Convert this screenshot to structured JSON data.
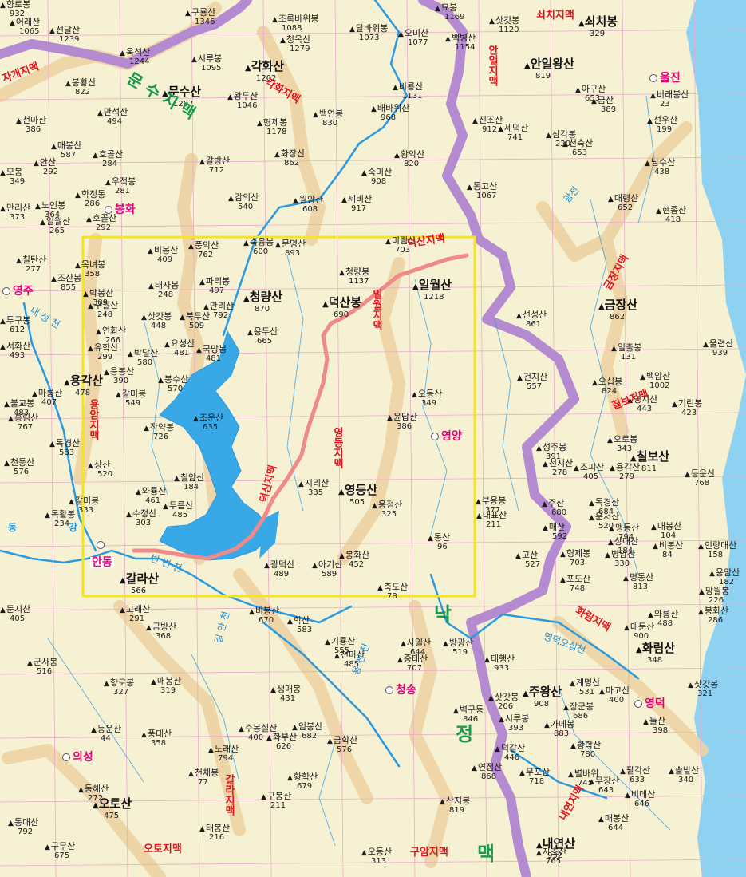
{
  "colors": {
    "land": "#f7f1d3",
    "sea": "#8fd1f0",
    "lake": "#39a8e6",
    "river": "#2a9ae0",
    "province_boundary": "#b48ad0",
    "ridge_band": "#ecd3a4",
    "grid": "#e9a9cb",
    "region_box": "#f6e41e",
    "highlight_ridge": "#ee8a8a",
    "city_text": "#e6007e",
    "ridge_text": "#e3131b",
    "ridge_text_blue": "#1b3c8f",
    "green_text": "#179a4a"
  },
  "icons": [
    "mountain-peak-icon",
    "city-marker-icon"
  ],
  "cities": [
    {
      "id": "yeongju",
      "name": "영주"
    },
    {
      "id": "bonghwa",
      "name": "봉화"
    },
    {
      "id": "uljin",
      "name": "울진"
    },
    {
      "id": "andong",
      "name": "안동"
    },
    {
      "id": "yeongyang",
      "name": "영양"
    },
    {
      "id": "cheongsong",
      "name": "청송"
    },
    {
      "id": "yeongdeok",
      "name": "영덕"
    },
    {
      "id": "uiseong",
      "name": "의성"
    }
  ],
  "ridges": [
    {
      "id": "jagye",
      "name": "자개지맥"
    },
    {
      "id": "gakhwa",
      "name": "각화지맥"
    },
    {
      "id": "anil",
      "name": "안일지맥"
    },
    {
      "id": "soechi",
      "name": "쇠치지맥"
    },
    {
      "id": "deoksan",
      "name": "덕산지맥"
    },
    {
      "id": "ilwol",
      "name": "일월지맥"
    },
    {
      "id": "geumjang",
      "name": "금장지맥"
    },
    {
      "id": "yongam",
      "name": "용암지맥"
    },
    {
      "id": "yeongdeung",
      "name": "영등지맥"
    },
    {
      "id": "deoksin",
      "name": "덕신지맥"
    },
    {
      "id": "chilbo",
      "name": "칠보지맥"
    },
    {
      "id": "hwarim",
      "name": "화림지맥"
    },
    {
      "id": "galla",
      "name": "갈라지맥"
    },
    {
      "id": "oto",
      "name": "오토지맥"
    },
    {
      "id": "guam",
      "name": "구암지맥"
    },
    {
      "id": "naeyeon",
      "name": "내연지맥"
    },
    {
      "id": "munsu",
      "name": "문 수 지 맥"
    },
    {
      "id": "nakdong",
      "name": "낙"
    },
    {
      "id": "jeong",
      "name": "정"
    },
    {
      "id": "maek",
      "name": "맥"
    }
  ],
  "water_labels": [
    {
      "id": "dong",
      "name": "동"
    },
    {
      "id": "gang",
      "name": "강"
    },
    {
      "id": "naeseongcheon",
      "name": "내 성 천"
    },
    {
      "id": "banbyeoncheon",
      "name": "반 변 천"
    },
    {
      "id": "gilancheon",
      "name": "길 안 천"
    },
    {
      "id": "yongjeoncheon",
      "name": "용 전 천"
    },
    {
      "id": "yeongdeokocheon",
      "name": "영덕오십천"
    },
    {
      "id": "gwangcheon",
      "name": "광천"
    }
  ],
  "major_peaks": [
    {
      "id": "munsusan",
      "name": "문수산",
      "elev": "1207"
    },
    {
      "id": "gakhwasan",
      "name": "각화산",
      "elev": "1202"
    },
    {
      "id": "anilwangsan",
      "name": "안일왕산",
      "elev": "819"
    },
    {
      "id": "soechibong",
      "name": "쇠치봉",
      "elev": "329"
    },
    {
      "id": "cheongnyangsan",
      "name": "청량산",
      "elev": "870"
    },
    {
      "id": "deoksanbong",
      "name": "덕산봉",
      "elev": "690"
    },
    {
      "id": "irwolsan",
      "name": "일월산",
      "elev": "1218"
    },
    {
      "id": "geumjangsan",
      "name": "금장산",
      "elev": "862"
    },
    {
      "id": "yonggaksan",
      "name": "용각산",
      "elev": "478"
    },
    {
      "id": "yeongdeungsan",
      "name": "영등산",
      "elev": "505"
    },
    {
      "id": "galrasan",
      "name": "갈라산",
      "elev": "566"
    },
    {
      "id": "chilbosan",
      "name": "칠보산",
      "elev": "811"
    },
    {
      "id": "hwarimsan",
      "name": "화림산",
      "elev": "348"
    },
    {
      "id": "jusangsan",
      "name": "주왕산",
      "elev": "908"
    },
    {
      "id": "otosan",
      "name": "오토산",
      "elev": "475"
    },
    {
      "id": "naeyeonsan",
      "name": "내연산",
      "elev": "932"
    }
  ],
  "peaks": [
    {
      "id": "p001",
      "name": "어래산",
      "elev": "1065"
    },
    {
      "id": "p002",
      "name": "선달산",
      "elev": "1239"
    },
    {
      "id": "p003",
      "name": "옥석산",
      "elev": "1244"
    },
    {
      "id": "p004",
      "name": "구룡산",
      "elev": "1346"
    },
    {
      "id": "p005",
      "name": "시루봉",
      "elev": "1095"
    },
    {
      "id": "p006",
      "name": "조록바위봉",
      "elev": "1088"
    },
    {
      "id": "p007",
      "name": "달바위봉",
      "elev": "1073"
    },
    {
      "id": "p008",
      "name": "청옥산",
      "elev": "1279"
    },
    {
      "id": "p009",
      "name": "오미산",
      "elev": "1077"
    },
    {
      "id": "p010",
      "name": "묘봉",
      "elev": "1169"
    },
    {
      "id": "p011",
      "name": "백병산",
      "elev": "1154"
    },
    {
      "id": "p012",
      "name": "삿갓봉",
      "elev": "1120"
    },
    {
      "id": "p013",
      "name": "봉황산",
      "elev": "822"
    },
    {
      "id": "p014",
      "name": "만석산",
      "elev": "494"
    },
    {
      "id": "p015",
      "name": "천마산",
      "elev": "386"
    },
    {
      "id": "p016",
      "name": "매봉산",
      "elev": "587"
    },
    {
      "id": "p017",
      "name": "호골산",
      "elev": "284"
    },
    {
      "id": "p018",
      "name": "왕두산",
      "elev": "1046"
    },
    {
      "id": "p019",
      "name": "형제봉",
      "elev": "1178"
    },
    {
      "id": "p020",
      "name": "화장산",
      "elev": "862"
    },
    {
      "id": "p021",
      "name": "백연봉",
      "elev": "830"
    },
    {
      "id": "p022",
      "name": "비룡산",
      "elev": "1131"
    },
    {
      "id": "p023",
      "name": "배바위산",
      "elev": "968"
    },
    {
      "id": "p024",
      "name": "황악산",
      "elev": "820"
    },
    {
      "id": "p025",
      "name": "죽미산",
      "elev": "908"
    },
    {
      "id": "p026",
      "name": "진조산",
      "elev": "912"
    },
    {
      "id": "p027",
      "name": "세덕산",
      "elev": "741"
    },
    {
      "id": "p028",
      "name": "삼각봉",
      "elev": "220"
    },
    {
      "id": "p029",
      "name": "천축산",
      "elev": "653"
    },
    {
      "id": "p030",
      "name": "아구산",
      "elev": "653"
    },
    {
      "id": "p031",
      "name": "금산",
      "elev": "389"
    },
    {
      "id": "p032",
      "name": "비래봉산",
      "elev": "23"
    },
    {
      "id": "p033",
      "name": "선우산",
      "elev": "199"
    },
    {
      "id": "p034",
      "name": "남수산",
      "elev": "438"
    },
    {
      "id": "p035",
      "name": "모봉",
      "elev": "349"
    },
    {
      "id": "p036",
      "name": "안산",
      "elev": "292"
    },
    {
      "id": "p037",
      "name": "우적봉",
      "elev": "281"
    },
    {
      "id": "p038",
      "name": "학정동",
      "elev": "286"
    },
    {
      "id": "p039",
      "name": "갈방산",
      "elev": "712"
    },
    {
      "id": "p040",
      "name": "감의산",
      "elev": "540"
    },
    {
      "id": "p041",
      "name": "월암산",
      "elev": "608"
    },
    {
      "id": "p042",
      "name": "제비산",
      "elev": "917"
    },
    {
      "id": "p043",
      "name": "통고산",
      "elev": "1067"
    },
    {
      "id": "p044",
      "name": "대령산",
      "elev": "652"
    },
    {
      "id": "p045",
      "name": "현종산",
      "elev": "418"
    },
    {
      "id": "p046",
      "name": "노인봉",
      "elev": "364"
    },
    {
      "id": "p047",
      "name": "만리산",
      "elev": "373"
    },
    {
      "id": "p048",
      "name": "일월산",
      "elev": "265"
    },
    {
      "id": "p049",
      "name": "호골산",
      "elev": "292"
    },
    {
      "id": "p050",
      "name": "칠탄산",
      "elev": "277"
    },
    {
      "id": "p051",
      "name": "옥녀봉",
      "elev": "358"
    },
    {
      "id": "p052",
      "name": "비봉산",
      "elev": "409"
    },
    {
      "id": "p053",
      "name": "풍악산",
      "elev": "762"
    },
    {
      "id": "p054",
      "name": "축융봉",
      "elev": "600"
    },
    {
      "id": "p055",
      "name": "문명산",
      "elev": "893"
    },
    {
      "id": "p056",
      "name": "미림산",
      "elev": "703"
    },
    {
      "id": "p057",
      "name": "청량봉",
      "elev": "1137"
    },
    {
      "id": "p058",
      "name": "조산봉",
      "elev": "855"
    },
    {
      "id": "p059",
      "name": "박봉산",
      "elev": "389"
    },
    {
      "id": "p060",
      "name": "구월산",
      "elev": "248"
    },
    {
      "id": "p061",
      "name": "태자봉",
      "elev": "248"
    },
    {
      "id": "p062",
      "name": "파리봉",
      "elev": "497"
    },
    {
      "id": "p063",
      "name": "만리산",
      "elev": "792"
    },
    {
      "id": "p064",
      "name": "투구봉",
      "elev": "612"
    },
    {
      "id": "p065",
      "name": "연화산",
      "elev": "266"
    },
    {
      "id": "p066",
      "name": "삿갓봉",
      "elev": "448"
    },
    {
      "id": "p067",
      "name": "북두산",
      "elev": "509"
    },
    {
      "id": "p068",
      "name": "용두산",
      "elev": "665"
    },
    {
      "id": "p069",
      "name": "선성산",
      "elev": "861"
    },
    {
      "id": "p070",
      "name": "울련산",
      "elev": "939"
    },
    {
      "id": "p071",
      "name": "일출봉",
      "elev": "131"
    },
    {
      "id": "p072",
      "name": "서화산",
      "elev": "493"
    },
    {
      "id": "p073",
      "name": "유학산",
      "elev": "299"
    },
    {
      "id": "p074",
      "name": "박달산",
      "elev": "580"
    },
    {
      "id": "p075",
      "name": "요성산",
      "elev": "481"
    },
    {
      "id": "p076",
      "name": "국망봉",
      "elev": "481"
    },
    {
      "id": "p077",
      "name": "건지산",
      "elev": "557"
    },
    {
      "id": "p078",
      "name": "오십봉",
      "elev": "824"
    },
    {
      "id": "p079",
      "name": "백암산",
      "elev": "1002"
    },
    {
      "id": "p080",
      "name": "응봉산",
      "elev": "390"
    },
    {
      "id": "p081",
      "name": "봉수산",
      "elev": "570"
    },
    {
      "id": "p082",
      "name": "영지산",
      "elev": "443"
    },
    {
      "id": "p083",
      "name": "기린봉",
      "elev": "423"
    },
    {
      "id": "p084",
      "name": "마룡산",
      "elev": "407"
    },
    {
      "id": "p085",
      "name": "불교봉",
      "elev": "483"
    },
    {
      "id": "p086",
      "name": "갈미봉",
      "elev": "549"
    },
    {
      "id": "p087",
      "name": "오동산",
      "elev": "349"
    },
    {
      "id": "p088",
      "name": "흥림산",
      "elev": "767"
    },
    {
      "id": "p089",
      "name": "조운산",
      "elev": "635"
    },
    {
      "id": "p090",
      "name": "윤답산",
      "elev": "386"
    },
    {
      "id": "p091",
      "name": "작약봉",
      "elev": "726"
    },
    {
      "id": "p092",
      "name": "오로봉",
      "elev": "343"
    },
    {
      "id": "p093",
      "name": "성주봉",
      "elev": "391"
    },
    {
      "id": "p094",
      "name": "독경산",
      "elev": "583"
    },
    {
      "id": "p095",
      "name": "천등산",
      "elev": "576"
    },
    {
      "id": "p096",
      "name": "상산",
      "elev": "520"
    },
    {
      "id": "p097",
      "name": "천지산",
      "elev": "278"
    },
    {
      "id": "p098",
      "name": "조피산",
      "elev": "405"
    },
    {
      "id": "p099",
      "name": "용각산",
      "elev": "279"
    },
    {
      "id": "p100",
      "name": "등운산",
      "elev": "768"
    },
    {
      "id": "p101",
      "name": "칠암산",
      "elev": "184"
    },
    {
      "id": "p102",
      "name": "와룡산",
      "elev": "461"
    },
    {
      "id": "p103",
      "name": "지리산",
      "elev": "335"
    },
    {
      "id": "p104",
      "name": "두름산",
      "elev": "485"
    },
    {
      "id": "p105",
      "name": "수정산",
      "elev": "303"
    },
    {
      "id": "p106",
      "name": "용점산",
      "elev": "325"
    },
    {
      "id": "p107",
      "name": "부용봉",
      "elev": "377"
    },
    {
      "id": "p108",
      "name": "주산",
      "elev": "680"
    },
    {
      "id": "p109",
      "name": "독경산",
      "elev": "684"
    },
    {
      "id": "p110",
      "name": "운서산",
      "elev": "520"
    },
    {
      "id": "p111",
      "name": "갈미봉",
      "elev": "333"
    },
    {
      "id": "p112",
      "name": "독활봉",
      "elev": "234"
    },
    {
      "id": "p113",
      "name": "대표산",
      "elev": "211"
    },
    {
      "id": "p114",
      "name": "매산",
      "elev": "592"
    },
    {
      "id": "p115",
      "name": "맹동산",
      "elev": "794"
    },
    {
      "id": "p116",
      "name": "대봉산",
      "elev": "104"
    },
    {
      "id": "p117",
      "name": "인량대산",
      "elev": "158"
    },
    {
      "id": "p118",
      "name": "상대산",
      "elev": "184"
    },
    {
      "id": "p119",
      "name": "비봉산",
      "elev": "84"
    },
    {
      "id": "p120",
      "name": "동산",
      "elev": "96"
    },
    {
      "id": "p121",
      "name": "병암산",
      "elev": "330"
    },
    {
      "id": "p122",
      "name": "형제봉",
      "elev": "703"
    },
    {
      "id": "p123",
      "name": "봉화산",
      "elev": "452"
    },
    {
      "id": "p124",
      "name": "광덕산",
      "elev": "489"
    },
    {
      "id": "p125",
      "name": "아기산",
      "elev": "589"
    },
    {
      "id": "p126",
      "name": "고산",
      "elev": "527"
    },
    {
      "id": "p127",
      "name": "포도산",
      "elev": "748"
    },
    {
      "id": "p128",
      "name": "명동산",
      "elev": "813"
    },
    {
      "id": "p129",
      "name": "용암산",
      "elev": "182"
    },
    {
      "id": "p130",
      "name": "망월봉",
      "elev": "226"
    },
    {
      "id": "p131",
      "name": "봉화산",
      "elev": "286"
    },
    {
      "id": "p132",
      "name": "축도산",
      "elev": "78"
    },
    {
      "id": "p133",
      "name": "비봉산",
      "elev": "670"
    },
    {
      "id": "p134",
      "name": "학산",
      "elev": "583"
    },
    {
      "id": "p135",
      "name": "와룡산",
      "elev": "488"
    },
    {
      "id": "p136",
      "name": "고래산",
      "elev": "291"
    },
    {
      "id": "p137",
      "name": "둔지산",
      "elev": "405"
    },
    {
      "id": "p138",
      "name": "금방산",
      "elev": "368"
    },
    {
      "id": "p139",
      "name": "기룡산",
      "elev": "555"
    },
    {
      "id": "p140",
      "name": "천마산",
      "elev": "485"
    },
    {
      "id": "p141",
      "name": "사일산",
      "elev": "644"
    },
    {
      "id": "p142",
      "name": "중태산",
      "elev": "707"
    },
    {
      "id": "p143",
      "name": "방광산",
      "elev": "519"
    },
    {
      "id": "p144",
      "name": "태행산",
      "elev": "933"
    },
    {
      "id": "p145",
      "name": "대둔산",
      "elev": "900"
    },
    {
      "id": "p146",
      "name": "군사봉",
      "elev": "516"
    },
    {
      "id": "p147",
      "name": "향로봉",
      "elev": "327"
    },
    {
      "id": "p148",
      "name": "매봉산",
      "elev": "319"
    },
    {
      "id": "p149",
      "name": "생매봉",
      "elev": "431"
    },
    {
      "id": "p150",
      "name": "계명산",
      "elev": "531"
    },
    {
      "id": "p151",
      "name": "마고산",
      "elev": "400"
    },
    {
      "id": "p152",
      "name": "삿갓봉",
      "elev": "321"
    },
    {
      "id": "p153",
      "name": "삿갓봉",
      "elev": "206"
    },
    {
      "id": "p154",
      "name": "벽구등",
      "elev": "846"
    },
    {
      "id": "p155",
      "name": "장군봉",
      "elev": "686"
    },
    {
      "id": "p156",
      "name": "시루봉",
      "elev": "393"
    },
    {
      "id": "p157",
      "name": "가메봉",
      "elev": "883"
    },
    {
      "id": "p158",
      "name": "둘산",
      "elev": "398"
    },
    {
      "id": "p159",
      "name": "등운산",
      "elev": "44"
    },
    {
      "id": "p160",
      "name": "풍대산",
      "elev": "358"
    },
    {
      "id": "p161",
      "name": "수봉실산",
      "elev": "400"
    },
    {
      "id": "p162",
      "name": "임봉산",
      "elev": "682"
    },
    {
      "id": "p163",
      "name": "화부산",
      "elev": "626"
    },
    {
      "id": "p164",
      "name": "금학산",
      "elev": "576"
    },
    {
      "id": "p165",
      "name": "노래산",
      "elev": "794"
    },
    {
      "id": "p166",
      "name": "황학산",
      "elev": "780"
    },
    {
      "id": "p167",
      "name": "덕갈산",
      "elev": "446"
    },
    {
      "id": "p168",
      "name": "별바위",
      "elev": "745"
    },
    {
      "id": "p169",
      "name": "팔각산",
      "elev": "633"
    },
    {
      "id": "p170",
      "name": "솔밭산",
      "elev": "340"
    },
    {
      "id": "p171",
      "name": "천채봉",
      "elev": "77"
    },
    {
      "id": "p172",
      "name": "황학산",
      "elev": "679"
    },
    {
      "id": "p173",
      "name": "연점산",
      "elev": "868"
    },
    {
      "id": "p174",
      "name": "무포산",
      "elev": "718"
    },
    {
      "id": "p175",
      "name": "무장산",
      "elev": "643"
    },
    {
      "id": "p176",
      "name": "비데산",
      "elev": "646"
    },
    {
      "id": "p177",
      "name": "동해산",
      "elev": "272"
    },
    {
      "id": "p178",
      "name": "구봉산",
      "elev": "211"
    },
    {
      "id": "p179",
      "name": "산지봉",
      "elev": "819"
    },
    {
      "id": "p180",
      "name": "매봉산",
      "elev": "644"
    },
    {
      "id": "p181",
      "name": "동대산",
      "elev": "792"
    },
    {
      "id": "p182",
      "name": "태봉산",
      "elev": "216"
    },
    {
      "id": "p183",
      "name": "구무산",
      "elev": "675"
    },
    {
      "id": "p184",
      "name": "오동산",
      "elev": "313"
    },
    {
      "id": "p185",
      "name": "자초산",
      "elev": "765"
    },
    {
      "id": "p186",
      "name": "향로봉",
      "elev": "932"
    }
  ]
}
